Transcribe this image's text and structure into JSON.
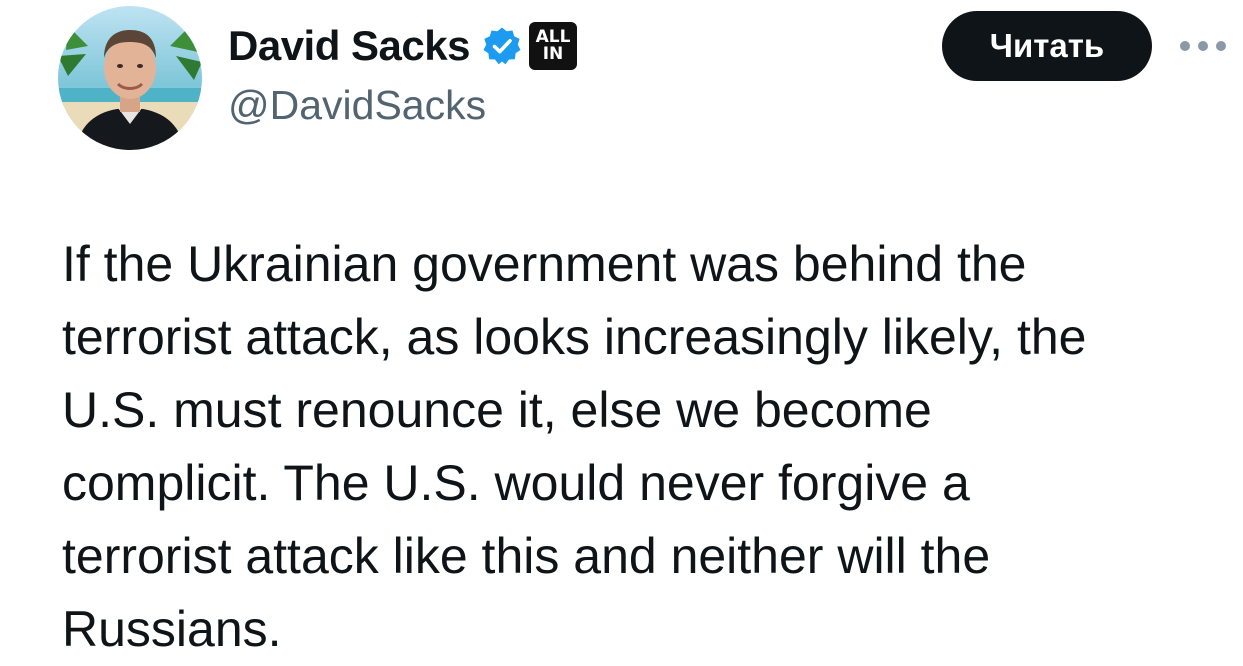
{
  "author": {
    "display_name": "David Sacks",
    "handle": "@DavidSacks",
    "verified": true,
    "affiliate_badge": {
      "line1": "ALL",
      "line2": "IN"
    }
  },
  "actions": {
    "follow_label": "Читать",
    "more_icon": "more-horizontal-icon"
  },
  "tweet": {
    "lines": [
      "If the Ukrainian government was behind the",
      "terrorist attack, as looks increasingly likely, the",
      "U.S. must renounce it, else we become",
      "complicit. The U.S. would never forgive a",
      "terrorist attack like this and neither will the",
      "Russians."
    ]
  },
  "colors": {
    "text": "#0f1419",
    "secondary_text": "#536471",
    "verified_blue": "#1d9bf0",
    "button_bg": "#0f1419"
  }
}
